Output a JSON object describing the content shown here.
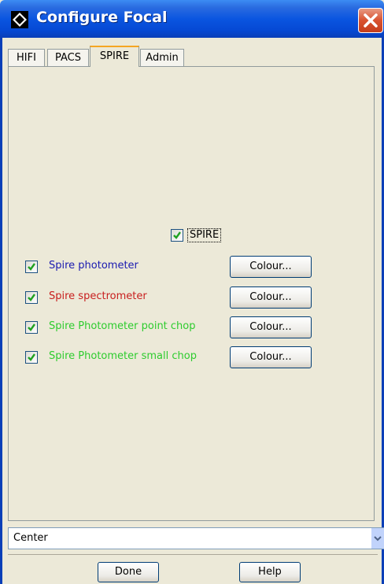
{
  "window": {
    "title": "Configure Focal"
  },
  "tabs": [
    {
      "label": "HIFI"
    },
    {
      "label": "PACS"
    },
    {
      "label": "SPIRE",
      "selected": true
    },
    {
      "label": "Admin"
    }
  ],
  "spire_panel": {
    "master": {
      "label": "SPIRE",
      "checked": true
    },
    "items": [
      {
        "label": "Spire photometer",
        "checked": true,
        "color": "#1A1AB0",
        "button": "Colour..."
      },
      {
        "label": "Spire spectrometer",
        "checked": true,
        "color": "#C81E1E",
        "button": "Colour..."
      },
      {
        "label": "Spire Photometer point chop",
        "checked": true,
        "color": "#2ECC2E",
        "button": "Colour..."
      },
      {
        "label": "Spire Photometer small chop",
        "checked": true,
        "color": "#2ECC2E",
        "button": "Colour..."
      }
    ]
  },
  "position_select": {
    "value": "Center"
  },
  "footer": {
    "done_label": "Done",
    "help_label": "Help"
  },
  "theme": {
    "titlebar": "#0A55E0",
    "check_color": "#21A121"
  }
}
